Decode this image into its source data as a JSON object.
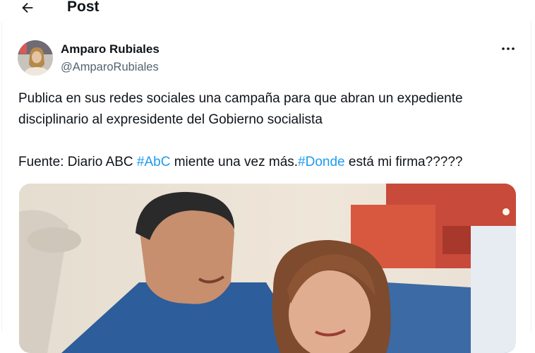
{
  "header": {
    "title": "Post",
    "back_icon": "arrow-left-icon"
  },
  "author": {
    "name": "Amparo Rubiales",
    "handle": "@AmparoRubiales"
  },
  "post": {
    "line1": "Publica en sus redes sociales una campaña para que abran un expediente",
    "line2": "disciplinario al expresidente del Gobierno socialista",
    "line3_a": "Fuente: Diario ABC ",
    "hashtag1": "#AbC",
    "line3_b": " miente una vez más.",
    "hashtag2": "#Donde",
    "line3_c": " está mi firma?????"
  },
  "colors": {
    "link": "#1d9bf0",
    "secondary_text": "#536471",
    "text": "#0f1419"
  },
  "icons": {
    "more": "more-horizontal-icon"
  }
}
